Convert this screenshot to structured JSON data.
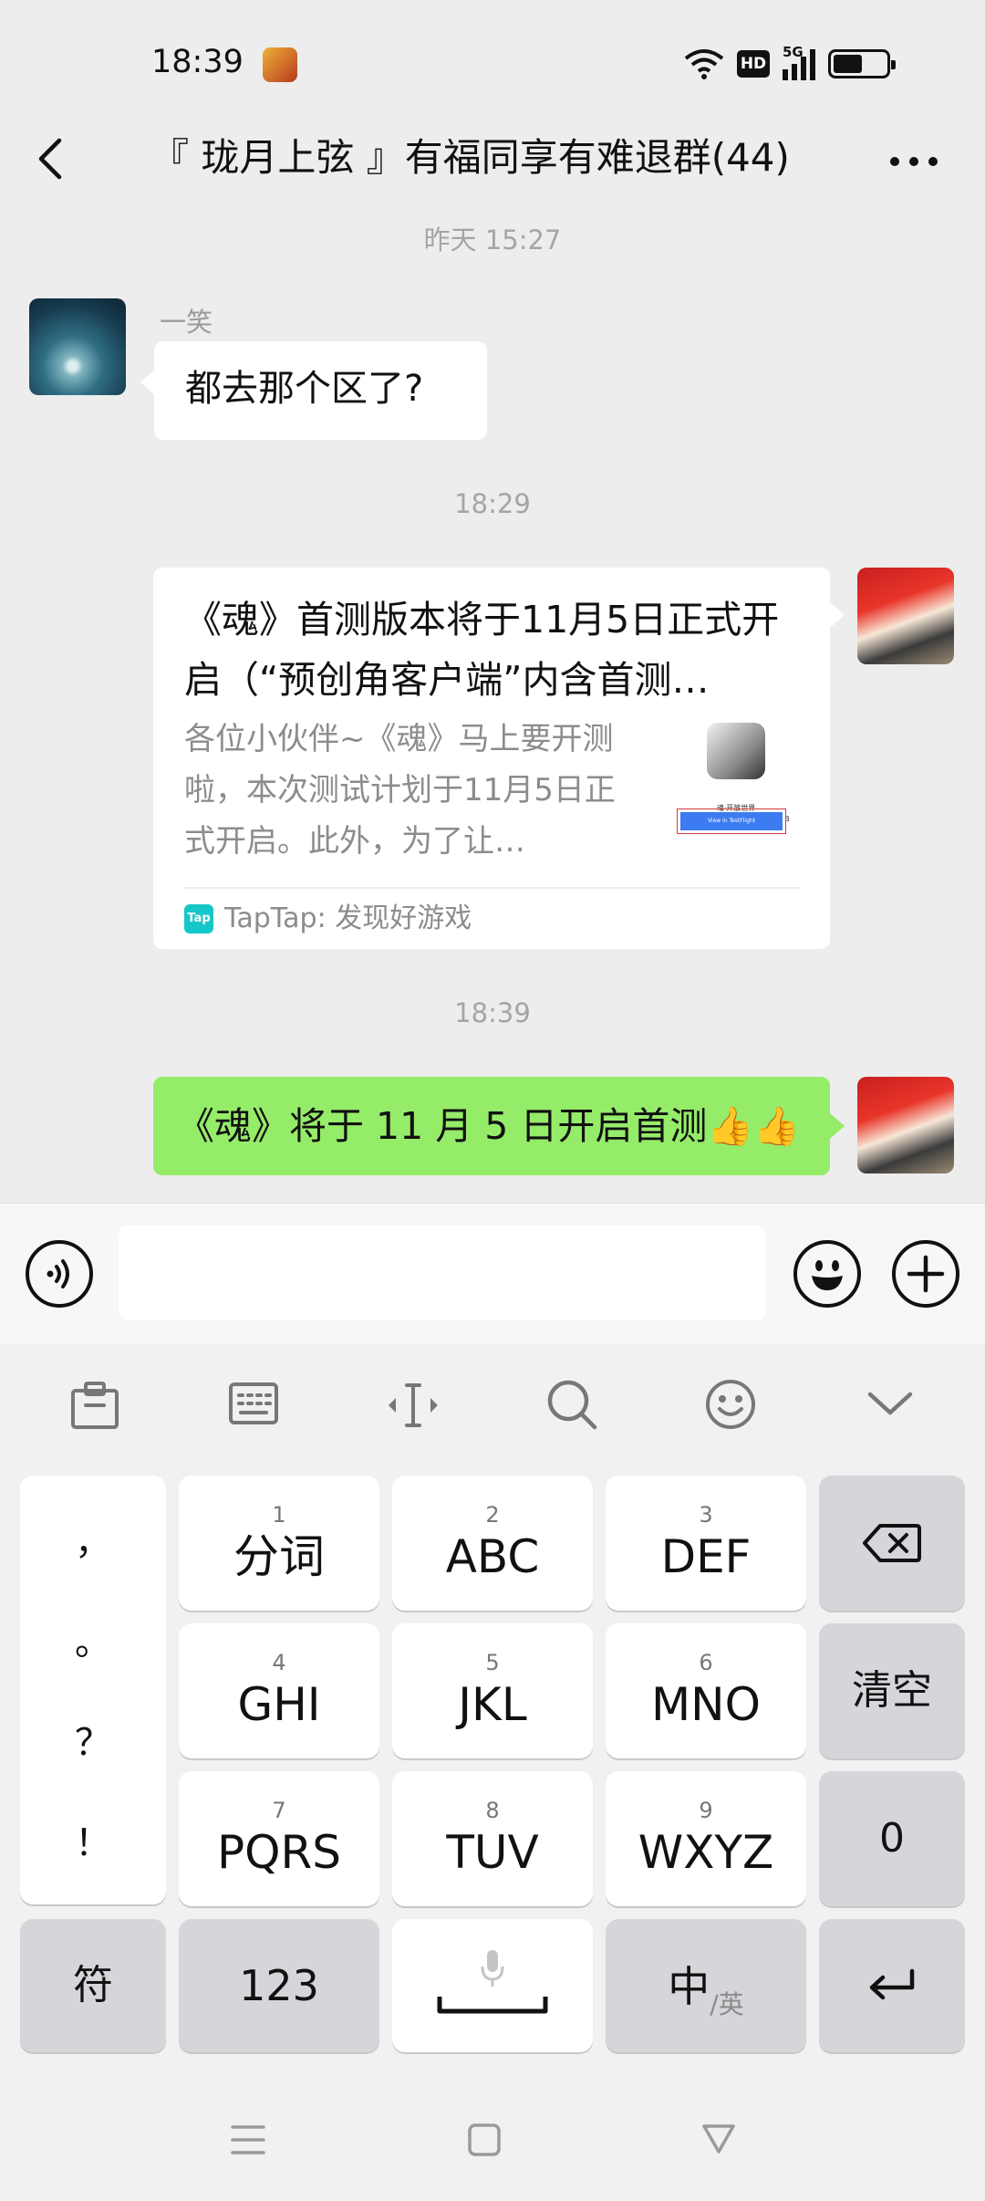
{
  "status_bar": {
    "time": "18:39",
    "app_icon": "game-app-icon",
    "hd_badge": "HD",
    "network_label": "5G",
    "battery_level": 0.55
  },
  "header": {
    "title": "『 珑月上弦 』有福同享有难退群(44)",
    "back_icon": "chevron-left-icon",
    "more_icon": "more-dots-icon"
  },
  "messages": {
    "ts_1": "昨天 15:27",
    "msg_1": {
      "sender": "一笑",
      "text": "都去那个区了?"
    },
    "ts_2": "18:29",
    "card": {
      "title": "《魂》首测版本将于11月5日正式开启（“预创角客户端”内含首测…",
      "description": "各位小伙伴~《魂》马上要开测啦，本次测试计划于11月5日正式开启。此外，为了让…",
      "source": "TapTap: 发现好游戏",
      "source_logo": "Tap",
      "thumb_text_1": "魂·开放世界",
      "thumb_text_2": "上海骆鹿互娱科技有限公司 for B",
      "thumb_button": "View in TestFlight"
    },
    "ts_3": "18:39",
    "msg_self": {
      "text": "《魂》将于 11 月 5 日开启首测👍👍"
    }
  },
  "input_bar": {
    "voice_icon": "voice-icon",
    "emoji_icon": "smiley-icon",
    "plus_icon": "plus-circle-icon",
    "value": ""
  },
  "keyboard": {
    "toolbar_icons": [
      "clipboard-icon",
      "keyboard-icon",
      "cursor-move-icon",
      "search-icon",
      "emoji-icon",
      "collapse-chevron-icon"
    ],
    "punctuation": [
      "，",
      "。",
      "？",
      "！"
    ],
    "keys": [
      {
        "num": "1",
        "label": "分词"
      },
      {
        "num": "2",
        "label": "ABC"
      },
      {
        "num": "3",
        "label": "DEF"
      },
      {
        "num": "4",
        "label": "GHI"
      },
      {
        "num": "5",
        "label": "JKL"
      },
      {
        "num": "6",
        "label": "MNO"
      },
      {
        "num": "7",
        "label": "PQRS"
      },
      {
        "num": "8",
        "label": "TUV"
      },
      {
        "num": "9",
        "label": "WXYZ"
      }
    ],
    "clear_label": "清空",
    "zero_label": "0",
    "symbol_label": "符",
    "numbers_label": "123",
    "lang_main": "中",
    "lang_sub": "/英",
    "backspace_icon": "backspace-icon",
    "enter_icon": "enter-icon",
    "mic_icon": "microphone-icon"
  },
  "nav_bar": {
    "menu_icon": "menu-icon",
    "home_icon": "home-square-icon",
    "back_icon": "back-triangle-icon"
  }
}
